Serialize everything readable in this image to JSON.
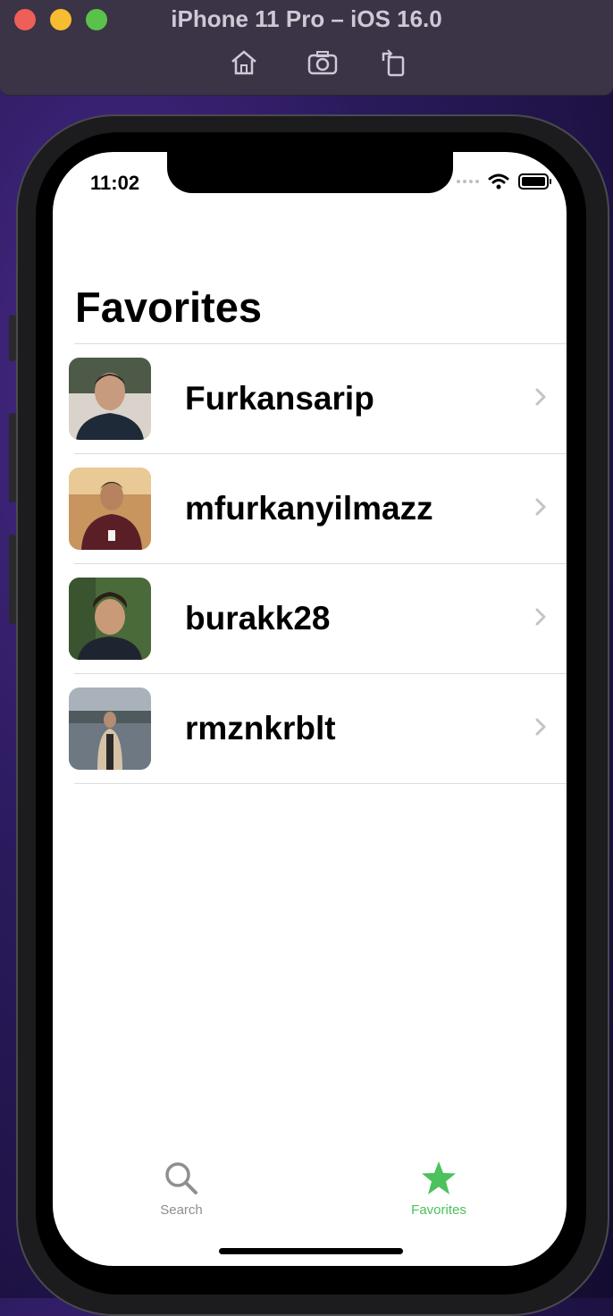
{
  "window": {
    "title": "iPhone 11 Pro – iOS 16.0",
    "toolbar": [
      "home-icon",
      "screenshot-icon",
      "rotate-icon"
    ]
  },
  "status_bar": {
    "time": "11:02",
    "icons": [
      "cellular-dots-icon",
      "wifi-icon",
      "battery-icon"
    ]
  },
  "main": {
    "title": "Favorites",
    "favorites": [
      {
        "username": "Furkansarip",
        "avatar_colors": [
          "#3c4a3e",
          "#d9d3cc"
        ]
      },
      {
        "username": "mfurkanyilmazz",
        "avatar_colors": [
          "#5a3a22",
          "#e7c59a"
        ]
      },
      {
        "username": "burakk28",
        "avatar_colors": [
          "#4a6a3a",
          "#2e3a2a"
        ]
      },
      {
        "username": "rmznkrblt",
        "avatar_colors": [
          "#8a94a0",
          "#5b626b"
        ]
      }
    ]
  },
  "tab_bar": {
    "tabs": [
      {
        "label": "Search",
        "icon": "search-icon",
        "selected": false
      },
      {
        "label": "Favorites",
        "icon": "star-icon",
        "selected": true
      }
    ],
    "accent": "#4cc15c",
    "inactive": "#8e8e93"
  }
}
